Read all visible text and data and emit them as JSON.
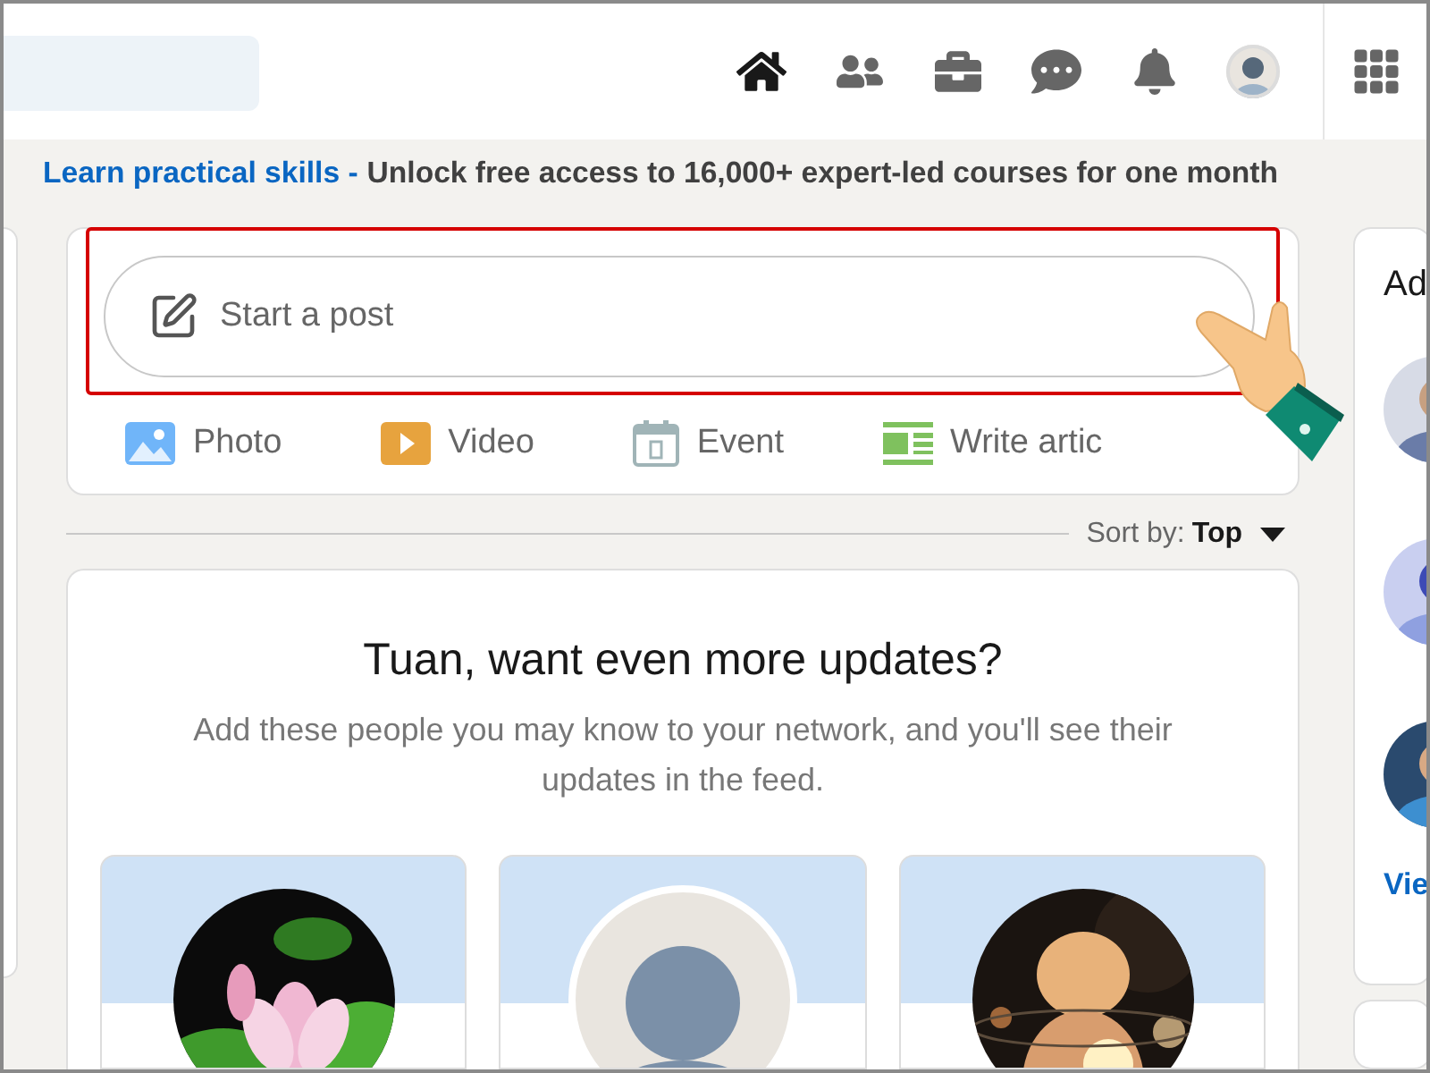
{
  "nav": {
    "items": [
      {
        "kind": "home",
        "selected": true
      },
      {
        "kind": "network",
        "selected": false
      },
      {
        "kind": "jobs",
        "selected": false
      },
      {
        "kind": "messaging",
        "selected": false
      },
      {
        "kind": "notifications",
        "selected": false
      },
      {
        "kind": "me",
        "selected": false
      },
      {
        "kind": "apps",
        "selected": false
      }
    ]
  },
  "banner": {
    "link": "Learn practical skills -",
    "text": "Unlock free access to 16,000+ expert-led courses for one month"
  },
  "composer": {
    "placeholder": "Start a post",
    "highlighted": true,
    "actions": [
      {
        "label": "Photo"
      },
      {
        "kind": "video",
        "label": "Video"
      },
      {
        "kind": "event",
        "label": "Event"
      },
      {
        "kind": "article",
        "label": "Write artic"
      }
    ]
  },
  "sort": {
    "label": "Sort by:",
    "value": "Top"
  },
  "feed_card": {
    "title": "Tuan, want even more updates?",
    "subtitle": "Add these people you may know to your network, and you'll see their updates in the feed.",
    "people": [
      {
        "kind": "picture"
      },
      {
        "kind": "avatar"
      },
      {
        "kind": "picture"
      }
    ]
  },
  "sidebar": {
    "title": "Ad",
    "link": "Vie",
    "items": [
      {
        "kind": "picture"
      },
      {
        "kind": "picture"
      },
      {
        "kind": "picture"
      }
    ]
  }
}
